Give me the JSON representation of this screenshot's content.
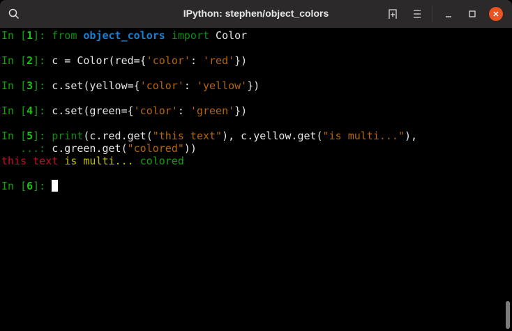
{
  "window": {
    "title": "IPython: stephen/object_colors",
    "icons": [
      "search-icon",
      "new-tab-icon",
      "menu-icon",
      "minimize-icon",
      "maximize-icon",
      "close-icon"
    ],
    "accent": "#e95420"
  },
  "terminal": {
    "lines": [
      [
        {
          "t": "In [",
          "c": "prompt"
        },
        {
          "t": "1",
          "c": "num"
        },
        {
          "t": "]: ",
          "c": "prompt"
        },
        {
          "t": "from",
          "c": "kw"
        },
        {
          "t": " ",
          "c": "txt"
        },
        {
          "t": "object_colors",
          "c": "mod"
        },
        {
          "t": " ",
          "c": "txt"
        },
        {
          "t": "import",
          "c": "kw"
        },
        {
          "t": " Color",
          "c": "txt"
        }
      ],
      [],
      [
        {
          "t": "In [",
          "c": "prompt"
        },
        {
          "t": "2",
          "c": "num"
        },
        {
          "t": "]: ",
          "c": "prompt"
        },
        {
          "t": "c = Color(red={",
          "c": "txt"
        },
        {
          "t": "'color'",
          "c": "str"
        },
        {
          "t": ": ",
          "c": "txt"
        },
        {
          "t": "'red'",
          "c": "str"
        },
        {
          "t": "})",
          "c": "txt"
        }
      ],
      [],
      [
        {
          "t": "In [",
          "c": "prompt"
        },
        {
          "t": "3",
          "c": "num"
        },
        {
          "t": "]: ",
          "c": "prompt"
        },
        {
          "t": "c.set(yellow={",
          "c": "txt"
        },
        {
          "t": "'color'",
          "c": "str"
        },
        {
          "t": ": ",
          "c": "txt"
        },
        {
          "t": "'yellow'",
          "c": "str"
        },
        {
          "t": "})",
          "c": "txt"
        }
      ],
      [],
      [
        {
          "t": "In [",
          "c": "prompt"
        },
        {
          "t": "4",
          "c": "num"
        },
        {
          "t": "]: ",
          "c": "prompt"
        },
        {
          "t": "c.set(green={",
          "c": "txt"
        },
        {
          "t": "'color'",
          "c": "str"
        },
        {
          "t": ": ",
          "c": "txt"
        },
        {
          "t": "'green'",
          "c": "str"
        },
        {
          "t": "})",
          "c": "txt"
        }
      ],
      [],
      [
        {
          "t": "In [",
          "c": "prompt"
        },
        {
          "t": "5",
          "c": "num"
        },
        {
          "t": "]: ",
          "c": "prompt"
        },
        {
          "t": "print",
          "c": "builtin"
        },
        {
          "t": "(c.red.get(",
          "c": "txt"
        },
        {
          "t": "\"this text\"",
          "c": "str"
        },
        {
          "t": "), c.yellow.get(",
          "c": "txt"
        },
        {
          "t": "\"is multi...\"",
          "c": "str"
        },
        {
          "t": "),",
          "c": "txt"
        }
      ],
      [
        {
          "t": "   ...: ",
          "c": "cont"
        },
        {
          "t": "c.green.get(",
          "c": "txt"
        },
        {
          "t": "\"colored\"",
          "c": "str"
        },
        {
          "t": "))",
          "c": "txt"
        }
      ],
      [
        {
          "t": "this text",
          "c": "red"
        },
        {
          "t": " ",
          "c": "txt"
        },
        {
          "t": "is multi...",
          "c": "yellow"
        },
        {
          "t": " ",
          "c": "txt"
        },
        {
          "t": "colored",
          "c": "green"
        }
      ],
      [],
      [
        {
          "t": "In [",
          "c": "prompt"
        },
        {
          "t": "6",
          "c": "num"
        },
        {
          "t": "]: ",
          "c": "prompt"
        }
      ]
    ]
  }
}
